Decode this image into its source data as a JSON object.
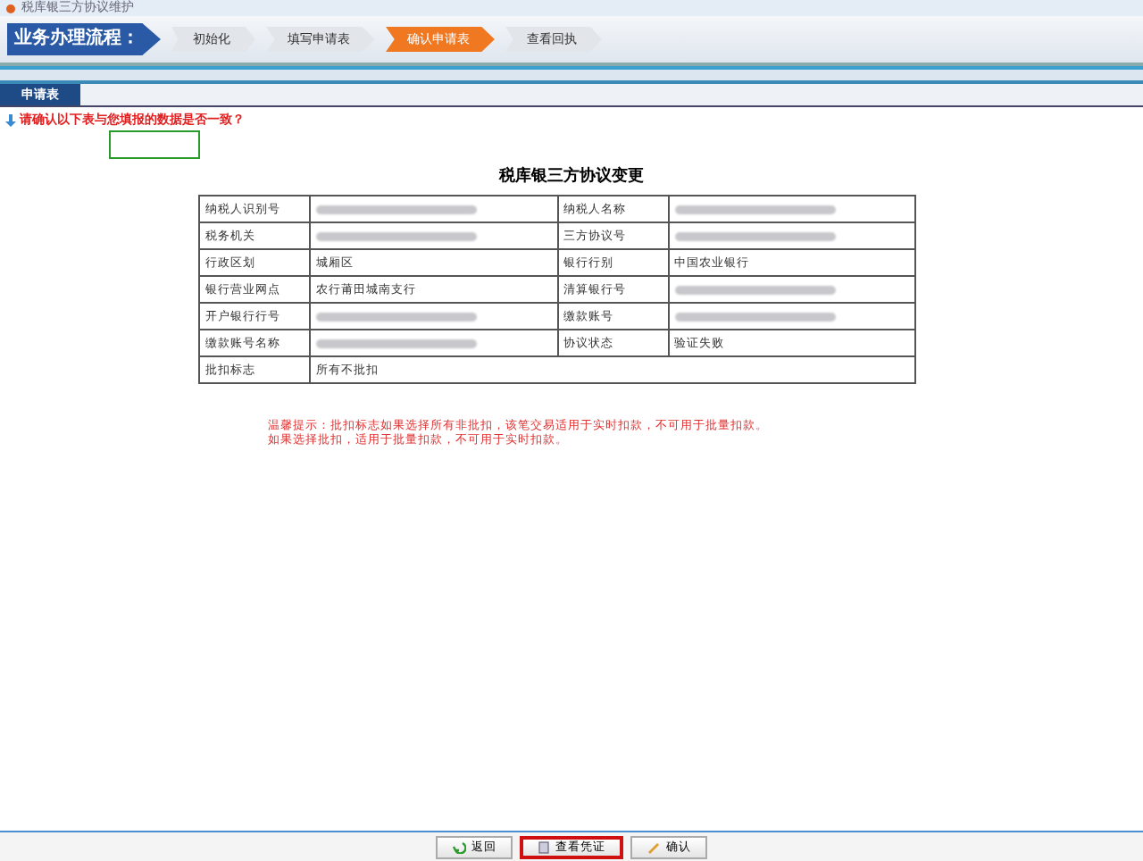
{
  "window": {
    "title": "税库银三方协议维护"
  },
  "process": {
    "label": "业务办理流程：",
    "steps": [
      {
        "label": "初始化",
        "selected": false
      },
      {
        "label": "填写申请表",
        "selected": false
      },
      {
        "label": "确认申请表",
        "selected": true
      },
      {
        "label": "查看回执",
        "selected": false
      }
    ]
  },
  "tabs": [
    {
      "label": "申请表",
      "selected": true
    }
  ],
  "prompt": "请确认以下表与您填报的数据是否一致？",
  "form": {
    "title": "税库银三方协议变更",
    "rows": [
      [
        {
          "label": "纳税人识别号",
          "value": {
            "kind": "redacted"
          }
        },
        {
          "label": "纳税人名称",
          "value": {
            "kind": "redacted"
          }
        }
      ],
      [
        {
          "label": "税务机关",
          "value": {
            "kind": "redacted"
          }
        },
        {
          "label": "三方协议号",
          "value": {
            "kind": "redacted"
          }
        }
      ],
      [
        {
          "label": "行政区划",
          "value": {
            "kind": "text",
            "text": "城厢区"
          }
        },
        {
          "label": "银行行别",
          "value": {
            "kind": "text",
            "text": "中国农业银行"
          }
        }
      ],
      [
        {
          "label": "银行营业网点",
          "value": {
            "kind": "text",
            "text": "农行莆田城南支行"
          }
        },
        {
          "label": "清算银行号",
          "value": {
            "kind": "redacted"
          }
        }
      ],
      [
        {
          "label": "开户银行行号",
          "value": {
            "kind": "redacted"
          }
        },
        {
          "label": "缴款账号",
          "value": {
            "kind": "redacted"
          }
        }
      ],
      [
        {
          "label": "缴款账号名称",
          "value": {
            "kind": "redacted"
          }
        },
        {
          "label": "协议状态",
          "value": {
            "kind": "text",
            "text": "验证失败"
          }
        }
      ],
      [
        {
          "label": "批扣标志",
          "value": {
            "kind": "text",
            "text": "所有不批扣"
          }
        }
      ]
    ]
  },
  "notice": [
    "温馨提示：批扣标志如果选择所有非批扣，该笔交易适用于实时扣款，不可用于批量扣款。",
    "如果选择批扣，适用于批量扣款，不可用于实时扣款。"
  ],
  "buttons": [
    {
      "label": "返回",
      "kind": "back",
      "highlighted": false
    },
    {
      "label": "查看凭证",
      "kind": "view",
      "highlighted": true
    },
    {
      "label": "确认",
      "kind": "confirm",
      "highlighted": false
    }
  ]
}
